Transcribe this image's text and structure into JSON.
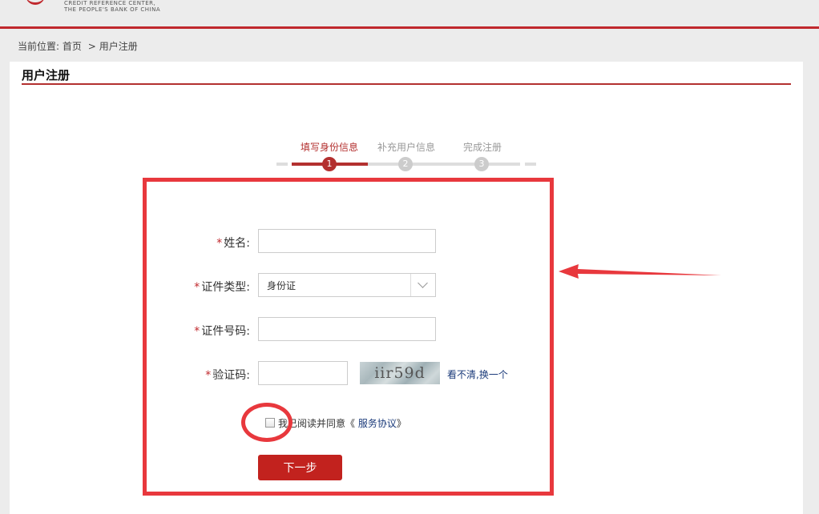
{
  "header": {
    "logo_line1": "CREDIT REFERENCE CENTER,",
    "logo_line2": "THE PEOPLE'S BANK OF CHINA"
  },
  "breadcrumb": {
    "prefix": "当前位置:",
    "home": "首页",
    "separator": ">",
    "current": "用户注册"
  },
  "page": {
    "title": "用户注册"
  },
  "steps": [
    {
      "label": "填写身份信息",
      "number": "1",
      "state": "active"
    },
    {
      "label": "补充用户信息",
      "number": "2",
      "state": "inactive"
    },
    {
      "label": "完成注册",
      "number": "3",
      "state": "inactive"
    }
  ],
  "form": {
    "required_mark": "*",
    "name_label": "姓名:",
    "name_value": "",
    "id_type_label": "证件类型:",
    "id_type_value": "身份证",
    "id_number_label": "证件号码:",
    "id_number_value": "",
    "captcha_label": "验证码:",
    "captcha_value": "",
    "captcha_image_text": "iir59d",
    "refresh_link": "看不清,换一个",
    "agree_text": "我已阅读并同意《",
    "agreement_link": "服务协议",
    "agree_close": "》",
    "next_button": "下一步"
  },
  "colors": {
    "brand_red": "#c0282d",
    "annotation_red": "#e8383d",
    "link_blue": "#1a3a7a"
  }
}
